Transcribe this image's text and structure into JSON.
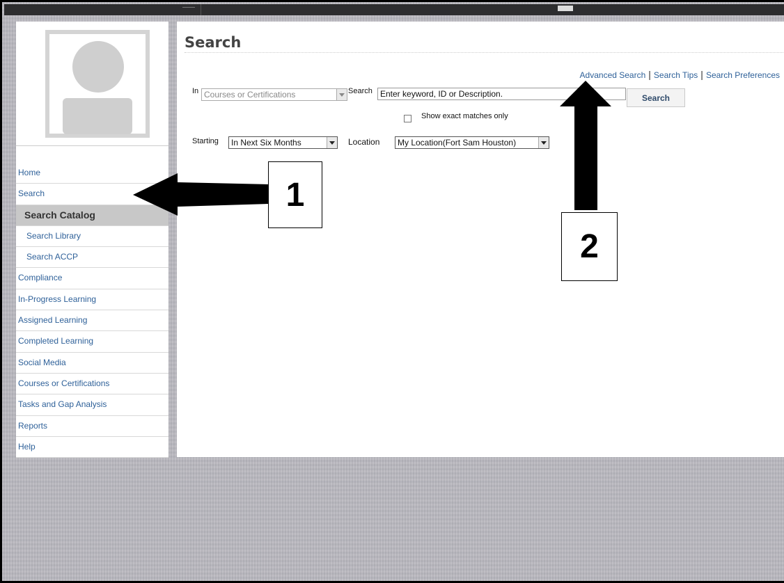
{
  "page": {
    "title": "Search"
  },
  "sidebar": {
    "items": [
      {
        "label": "Home",
        "type": "main",
        "active": false
      },
      {
        "label": "Search",
        "type": "main",
        "active": false
      },
      {
        "label": "Search Catalog",
        "type": "sub",
        "active": true
      },
      {
        "label": "Search Library",
        "type": "sub",
        "active": false
      },
      {
        "label": "Search ACCP",
        "type": "sub",
        "active": false
      },
      {
        "label": "Compliance",
        "type": "main",
        "active": false
      },
      {
        "label": "In-Progress Learning",
        "type": "main",
        "active": false
      },
      {
        "label": "Assigned Learning",
        "type": "main",
        "active": false
      },
      {
        "label": "Completed Learning",
        "type": "main",
        "active": false
      },
      {
        "label": "Social Media",
        "type": "main",
        "active": false
      },
      {
        "label": "Courses or Certifications",
        "type": "main",
        "active": false
      },
      {
        "label": "Tasks and Gap Analysis",
        "type": "main",
        "active": false
      },
      {
        "label": "Reports",
        "type": "main",
        "active": false
      },
      {
        "label": "Help",
        "type": "main",
        "active": false
      }
    ]
  },
  "links": {
    "advanced_search": "Advanced Search",
    "search_tips": "Search Tips",
    "search_preferences": "Search Preferences",
    "separator": "|"
  },
  "form": {
    "in_label": "In",
    "in_value": "Courses or Certifications",
    "search_label": "Search",
    "search_value": "Enter keyword, ID or Description.",
    "search_button": "Search",
    "exact_label": "Show exact matches only",
    "starting_label": "Starting",
    "starting_value": "In Next Six Months",
    "location_label": "Location",
    "location_value": "My Location(Fort Sam Houston)"
  },
  "callouts": {
    "one": "1",
    "two": "2"
  },
  "colors": {
    "link": "#2f6199",
    "background": "#b8b7be",
    "active_nav": "#c8c8c8"
  },
  "icons": {
    "avatar": "avatar-placeholder-icon",
    "dropdown": "chevron-down-icon",
    "arrow": "arrow-icon"
  }
}
